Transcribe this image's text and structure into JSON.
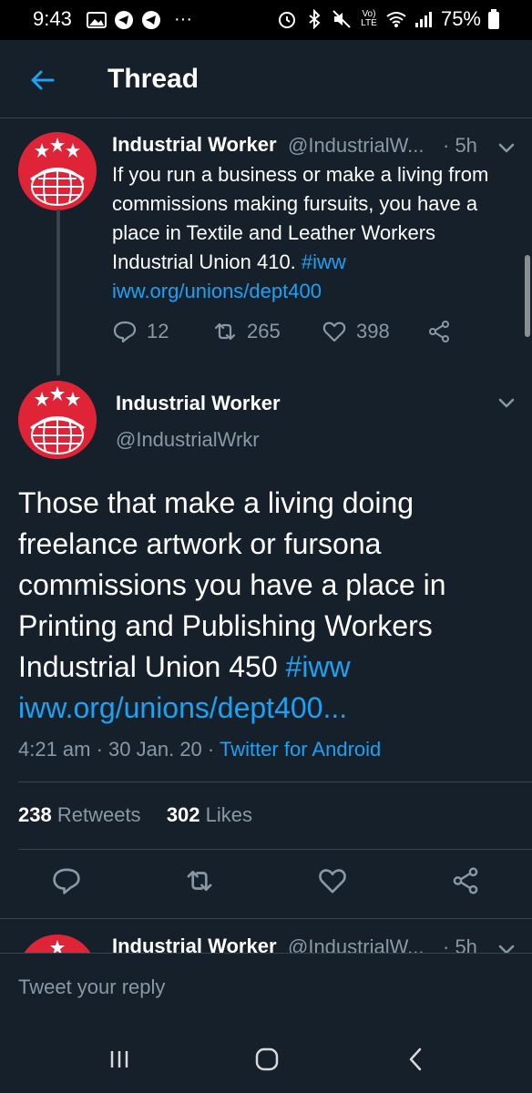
{
  "status_bar": {
    "time": "9:43",
    "dots": "···",
    "battery": "75%",
    "volte": "Vo) LTE"
  },
  "header": {
    "title": "Thread"
  },
  "tweets": [
    {
      "name": "Industrial Worker",
      "handle": "@IndustrialW...",
      "time": "· 5h",
      "body_text": "If you run a business or make a living from commissions making fursuits, you have a place in Textile and Leather Workers Industrial Union 410.",
      "hashtag": "#iww",
      "link": "iww.org/unions/dept400",
      "replies": "12",
      "retweets": "265",
      "likes": "398"
    },
    {
      "name": "Industrial Worker",
      "handle": "@IndustrialWrkr",
      "body_text": "Those that make a living doing freelance artwork or fursona commissions you have a place in Printing and Publishing Workers Industrial Union 450",
      "hashtag": "#iww",
      "link": "iww.org/unions/dept400...",
      "datetime": "4:21 am · 30 Jan. 20 · ",
      "source": "Twitter for Android",
      "retweet_count": "238",
      "retweet_label": "Retweets",
      "like_count": "302",
      "like_label": "Likes"
    },
    {
      "name": "Industrial Worker",
      "handle": "@IndustrialW...",
      "time": "· 5h"
    }
  ],
  "reply": {
    "placeholder": "Tweet your reply"
  },
  "colors": {
    "background": "#15202b",
    "accent": "#1da1f2",
    "secondary_text": "#8899a6",
    "avatar_red": "#e02438",
    "divider": "#38444d"
  }
}
